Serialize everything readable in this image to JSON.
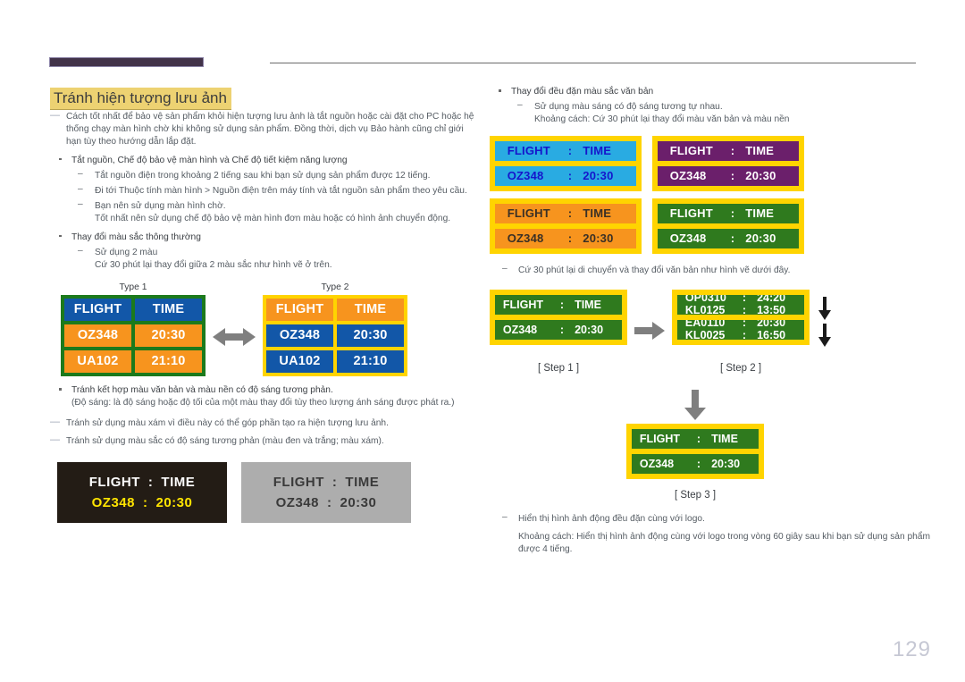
{
  "page": {
    "title": "Tránh hiện tượng lưu ảnh",
    "number": "129"
  },
  "left": {
    "note1": "Cách tốt nhất để bảo vệ sản phẩm khỏi hiện tượng lưu ảnh là tắt nguồn hoặc cài đặt cho PC hoặc hệ thống chạy màn hình chờ khi không sử dụng sản phẩm. Đồng thời, dịch vụ Bảo hành cũng chỉ giới hạn tùy theo hướng dẫn lắp đặt.",
    "bullet1": "Tắt nguồn, Chế độ bảo vệ màn hình và Chế độ tiết kiệm năng lượng",
    "sub1": "Tắt nguồn điện trong khoảng 2 tiếng sau khi bạn sử dụng sản phẩm được 12 tiếng.",
    "sub2": "Đi tới Thuộc tính màn hình > Nguồn điện trên máy tính và tắt nguồn sản phẩm theo yêu cầu.",
    "sub3": "Bạn nên sử dụng màn hình chờ.",
    "sub3_cont": "Tốt nhất nên sử dụng chế độ bảo vệ màn hình đơn màu hoặc có hình ảnh chuyển động.",
    "bullet2": "Thay đổi màu sắc thông thường",
    "sub4": "Sử dụng 2 màu",
    "sub4_cont": "Cứ 30 phút lại thay đổi giữa 2 màu sắc như hình vẽ ở trên.",
    "bullet3": "Tránh kết hợp màu văn bản và màu nền có độ sáng tương phản.",
    "bullet3_cont": "(Độ sáng: là độ sáng hoặc độ tối của một màu thay đổi tùy theo lượng ánh sáng được phát ra.)",
    "note2": "Tránh sử dụng màu xám vì điều này có thể góp phần tạo ra hiện tượng lưu ảnh.",
    "note3": "Tránh sử dụng màu sắc có độ sáng tương phản (màu đen và trắng; màu xám)."
  },
  "types": {
    "type1_label": "Type 1",
    "type2_label": "Type 2",
    "header": {
      "flight": "FLIGHT",
      "time": "TIME"
    },
    "rows": [
      {
        "flight": "OZ348",
        "time": "20:30"
      },
      {
        "flight": "UA102",
        "time": "21:10"
      }
    ],
    "type1_border": "#1c7a1c",
    "type2_border": "#ffd400",
    "type1_header_bg": "#1257a8",
    "type1_row_bg": "#f7941e",
    "type2_header_bg": "#f7941e",
    "type2_row_bg": "#1257a8",
    "swap_arrow": "double-arrow-horizontal"
  },
  "banners": [
    {
      "name": "dark",
      "bg": "#231c15",
      "line1": {
        "left": "FLIGHT",
        "sep": ":",
        "right": "TIME",
        "color": "#ffffff"
      },
      "line2": {
        "left": "OZ348",
        "sep": ":",
        "right": "20:30",
        "color": "#ffe400"
      }
    },
    {
      "name": "gray",
      "bg": "#adadad",
      "line1": {
        "left": "FLIGHT",
        "sep": ":",
        "right": "TIME",
        "color": "#3a3a3a"
      },
      "line2": {
        "left": "OZ348",
        "sep": ":",
        "right": "20:30",
        "color": "#3a3a3a"
      }
    }
  ],
  "right": {
    "bullet1": "Thay đổi đều đặn màu sắc văn bản",
    "sub1": "Sử dụng màu sáng có độ sáng tương tự nhau.",
    "sub1_cont": "Khoảng cách: Cứ 30 phút lại thay đổi màu văn bản và màu nền",
    "sub2": "Cứ 30 phút lại di chuyển và thay đổi văn bản như hình vẽ dưới đây.",
    "sub3": "Hiển thị hình ảnh động đều đặn cùng với logo.",
    "sub3_cont": "Khoảng cách: Hiển thị hình ảnh động cùng với logo trong vòng 60 giây sau khi bạn sử dụng sản phẩm được 4 tiếng."
  },
  "panels": [
    {
      "name": "cyan",
      "frame": "#ffd400",
      "bg": "#29abe2",
      "fg": "#1515cc",
      "line1": {
        "left": "FLIGHT",
        "sep": ":",
        "right": "TIME"
      },
      "line2": {
        "left": "OZ348",
        "sep": ":",
        "right": "20:30"
      }
    },
    {
      "name": "purple",
      "frame": "#ffd400",
      "bg": "#6b1f6b",
      "fg": "#ffffff",
      "line1": {
        "left": "FLIGHT",
        "sep": ":",
        "right": "TIME"
      },
      "line2": {
        "left": "OZ348",
        "sep": ":",
        "right": "20:30"
      }
    },
    {
      "name": "orange",
      "frame": "#ffd400",
      "bg": "#f7941e",
      "fg": "#3a3026",
      "line1": {
        "left": "FLIGHT",
        "sep": ":",
        "right": "TIME"
      },
      "line2": {
        "left": "OZ348",
        "sep": ":",
        "right": "20:30"
      }
    },
    {
      "name": "green",
      "frame": "#ffd400",
      "bg": "#2f7a1e",
      "fg": "#ffffff",
      "line1": {
        "left": "FLIGHT",
        "sep": ":",
        "right": "TIME"
      },
      "line2": {
        "left": "OZ348",
        "sep": ":",
        "right": "20:30"
      }
    }
  ],
  "steps": {
    "step1": {
      "caption": "[ Step 1 ]",
      "line1": {
        "left": "FLIGHT",
        "sep": ":",
        "right": "TIME"
      },
      "line2": {
        "left": "OZ348",
        "sep": ":",
        "right": "20:30"
      }
    },
    "step2": {
      "caption": "[ Step 2 ]",
      "bar1_row1": {
        "left": "OP0310",
        "sep": ":",
        "right": "24:20"
      },
      "bar1_row2": {
        "left": "KL0125",
        "sep": ":",
        "right": "13:50"
      },
      "bar2_row1": {
        "left": "EA0110",
        "sep": ":",
        "right": "20:30"
      },
      "bar2_row2": {
        "left": "KL0025",
        "sep": ":",
        "right": "16:50"
      }
    },
    "step3": {
      "caption": "[ Step 3 ]",
      "line1": {
        "left": "FLIGHT",
        "sep": ":",
        "right": "TIME"
      },
      "line2": {
        "left": "OZ348",
        "sep": ":",
        "right": "20:30"
      }
    },
    "arrow_right": "arrow-right-icon",
    "arrow_down": "arrow-down-icon"
  }
}
